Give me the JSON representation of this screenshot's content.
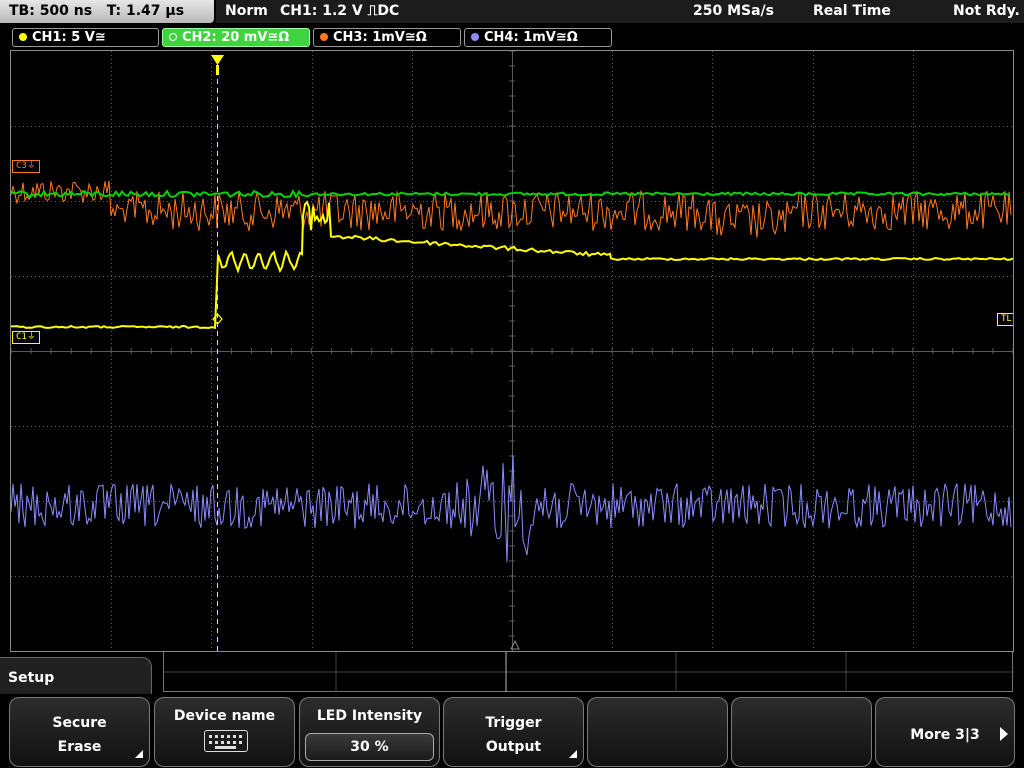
{
  "status": {
    "timebase": "TB: 500 ns",
    "trigger_time": "T: 1.47 µs",
    "trigger_mode": "Norm",
    "trigger_source": "CH1: 1.2 V ⎍DC",
    "sample_rate": "250 MSa/s",
    "acq_mode": "Real Time",
    "state": "Not Rdy."
  },
  "channels": [
    {
      "label": "CH1: 5 V≅",
      "color": "#ffff00"
    },
    {
      "label": "CH2: 20 mV≅Ω",
      "color": "#00e000",
      "active": true
    },
    {
      "label": "CH3: 1mV≅Ω",
      "color": "#ff7a20"
    },
    {
      "label": "CH4: 1mV≅Ω",
      "color": "#8c8cff"
    }
  ],
  "markers": {
    "c3": "C3⏚",
    "c1": "C1⏚",
    "tl": "TL"
  },
  "menu": {
    "title": "Setup",
    "keys": [
      {
        "line1": "Secure",
        "line2": "Erase",
        "submenu": true
      },
      {
        "line1": "Device name",
        "icon": "keyboard-icon"
      },
      {
        "line1": "LED Intensity",
        "value": "30 %"
      },
      {
        "line1": "Trigger",
        "line2": "Output",
        "submenu": true
      },
      {
        "line1": ""
      },
      {
        "line1": ""
      },
      {
        "line1": "More 3|3"
      }
    ]
  },
  "colors": {
    "ch1": "#ffff00",
    "ch2": "#00d400",
    "ch3": "#ff7a20",
    "ch4": "#8c8cff",
    "grid": "#5a5a5a"
  }
}
